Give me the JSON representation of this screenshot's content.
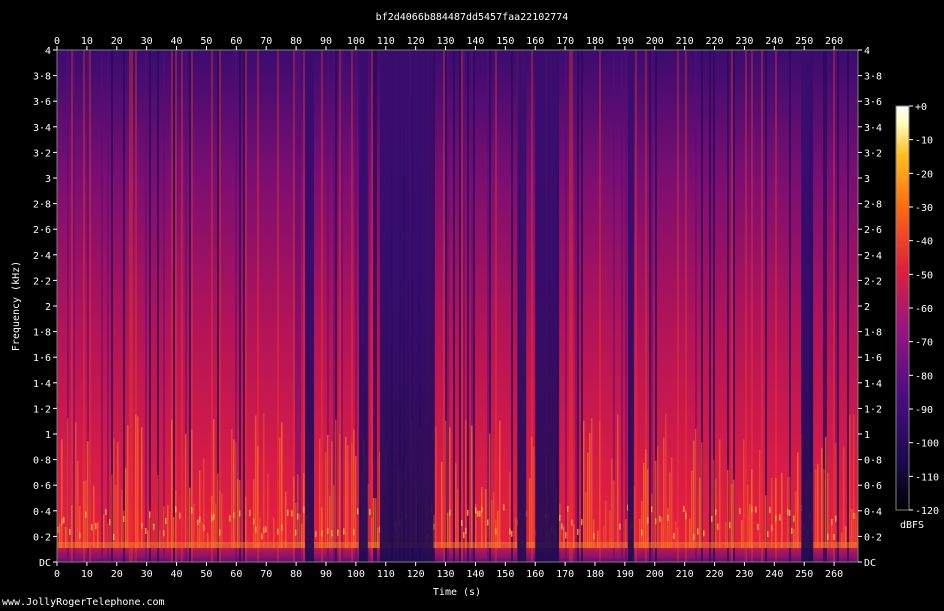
{
  "chart_data": {
    "type": "heatmap",
    "title": "bf2d4066b884487dd5457faa22102774",
    "xlabel": "Time (s)",
    "ylabel": "Frequency (kHz)",
    "xlim": [
      0,
      268
    ],
    "ylim": [
      0,
      4
    ],
    "x_ticks": [
      "0",
      "10",
      "20",
      "30",
      "40",
      "50",
      "60",
      "70",
      "80",
      "90",
      "100",
      "110",
      "120",
      "130",
      "140",
      "150",
      "160",
      "170",
      "180",
      "190",
      "200",
      "210",
      "220",
      "230",
      "240",
      "250",
      "260"
    ],
    "y_ticks": [
      "DC",
      "0·2",
      "0·4",
      "0·6",
      "0·8",
      "1",
      "1·2",
      "1·4",
      "1·6",
      "1·8",
      "2",
      "2·2",
      "2·4",
      "2·6",
      "2·8",
      "3",
      "3·2",
      "3·4",
      "3·6",
      "3·8",
      "4"
    ],
    "colorbar": {
      "label": "dBFS",
      "ticks": [
        "+0",
        "-10",
        "-20",
        "-30",
        "-40",
        "-50",
        "-60",
        "-70",
        "-80",
        "-90",
        "-100",
        "-110",
        "-120"
      ],
      "range": [
        -120,
        0
      ],
      "colors": [
        "#000000",
        "#1a0a4a",
        "#4a0c80",
        "#9a1480",
        "#e0203a",
        "#ff6a10",
        "#ffc020",
        "#ffffc0",
        "#ffffff"
      ]
    },
    "grid": false,
    "quiet_intervals_s": [
      [
        83,
        86
      ],
      [
        101,
        104
      ],
      [
        108,
        126
      ],
      [
        154,
        157
      ],
      [
        160,
        168
      ],
      [
        191,
        193
      ],
      [
        249,
        253
      ]
    ]
  },
  "watermark": "www.JollyRogerTelephone.com"
}
